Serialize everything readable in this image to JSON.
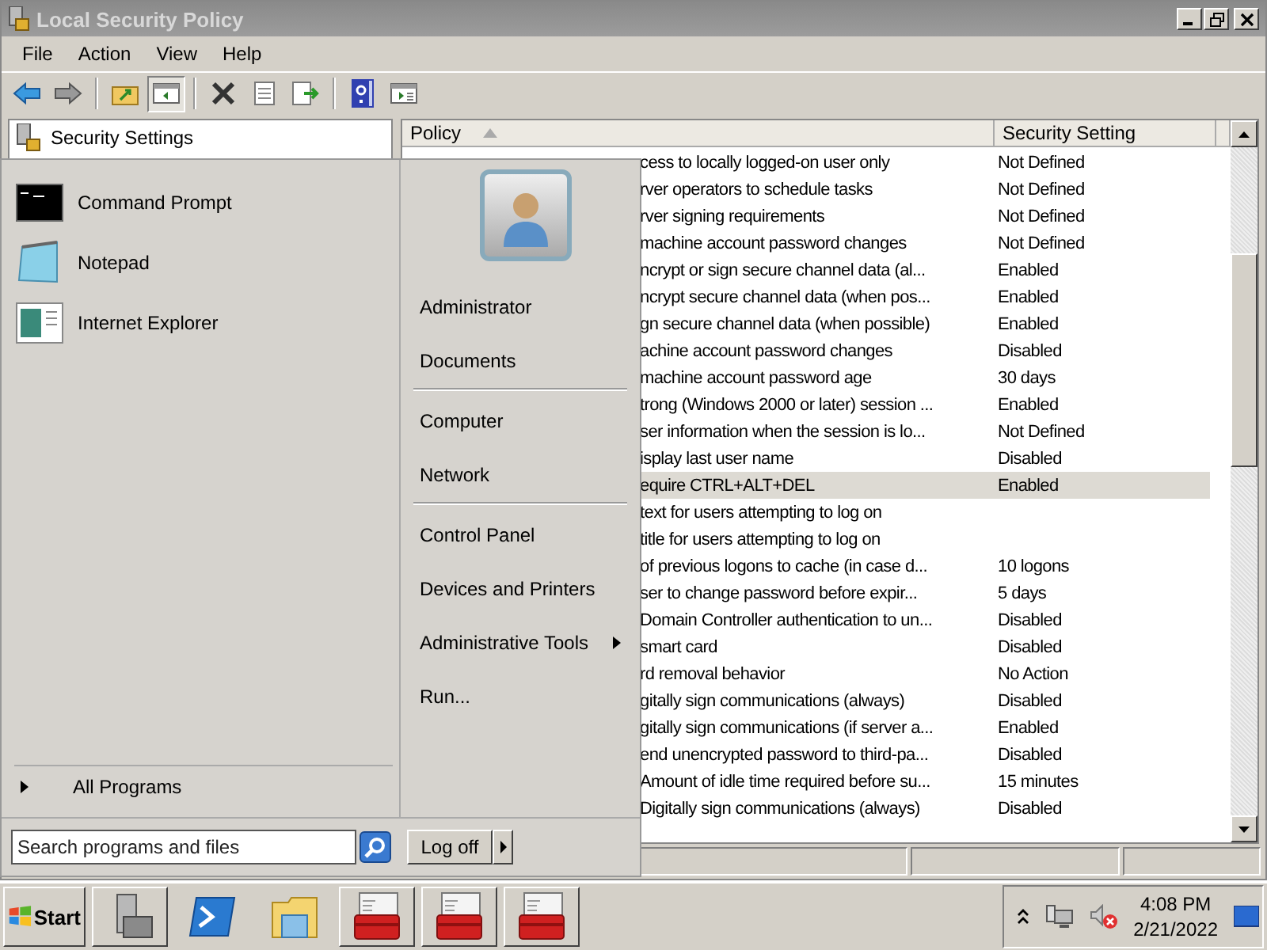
{
  "window": {
    "title": "Local Security Policy"
  },
  "menu": [
    "File",
    "Action",
    "View",
    "Help"
  ],
  "tree": {
    "items": [
      {
        "label": "Security Settings"
      }
    ]
  },
  "table": {
    "columns": [
      {
        "label": "Policy",
        "sorted": true
      },
      {
        "label": "Security Setting",
        "sorted": false
      }
    ],
    "rows": [
      {
        "policy": "cess to locally logged-on user only",
        "setting": "Not Defined",
        "selected": false
      },
      {
        "policy": "rver operators to schedule tasks",
        "setting": "Not Defined",
        "selected": false
      },
      {
        "policy": "rver signing requirements",
        "setting": "Not Defined",
        "selected": false
      },
      {
        "policy": "machine account password changes",
        "setting": "Not Defined",
        "selected": false
      },
      {
        "policy": "ncrypt or sign secure channel data (al...",
        "setting": "Enabled",
        "selected": false
      },
      {
        "policy": "ncrypt secure channel data (when pos...",
        "setting": "Enabled",
        "selected": false
      },
      {
        "policy": "gn secure channel data (when possible)",
        "setting": "Enabled",
        "selected": false
      },
      {
        "policy": "achine account password changes",
        "setting": "Disabled",
        "selected": false
      },
      {
        "policy": "machine account password age",
        "setting": "30 days",
        "selected": false
      },
      {
        "policy": "trong (Windows 2000 or later) session ...",
        "setting": "Enabled",
        "selected": false
      },
      {
        "policy": "ser information when the session is lo...",
        "setting": "Not Defined",
        "selected": false
      },
      {
        "policy": "isplay last user name",
        "setting": "Disabled",
        "selected": false
      },
      {
        "policy": "equire CTRL+ALT+DEL",
        "setting": "Enabled",
        "selected": true
      },
      {
        "policy": "text for users attempting to log on",
        "selected": false
      },
      {
        "policy": "title for users attempting to log on",
        "selected": false
      },
      {
        "policy": "of previous logons to cache (in case d...",
        "setting": "10 logons",
        "selected": false
      },
      {
        "policy": "ser to change password before expir...",
        "setting": "5 days",
        "selected": false
      },
      {
        "policy": "Domain Controller authentication to un...",
        "setting": "Disabled",
        "selected": false
      },
      {
        "policy": "smart card",
        "setting": "Disabled",
        "selected": false
      },
      {
        "policy": "rd removal behavior",
        "setting": "No Action",
        "selected": false
      },
      {
        "policy": "gitally sign communications (always)",
        "setting": "Disabled",
        "selected": false
      },
      {
        "policy": "gitally sign communications (if server a...",
        "setting": "Enabled",
        "selected": false
      },
      {
        "policy": "end unencrypted password to third-pa...",
        "setting": "Disabled",
        "selected": false
      },
      {
        "policy": "Amount of idle time required before su...",
        "setting": "15 minutes",
        "selected": false
      },
      {
        "policy": "Digitally sign communications (always)",
        "setting": "Disabled",
        "selected": false
      }
    ]
  },
  "start_menu": {
    "pinned": [
      {
        "label": "Command Prompt",
        "kind": "cmd"
      },
      {
        "label": "Notepad",
        "kind": "notepad"
      },
      {
        "label": "Internet Explorer",
        "kind": "browser"
      }
    ],
    "link_groups": [
      [
        {
          "label": "Administrator",
          "submenu": false
        },
        {
          "label": "Documents",
          "submenu": false
        }
      ],
      [
        {
          "label": "Computer",
          "submenu": false
        },
        {
          "label": "Network",
          "submenu": false
        }
      ],
      [
        {
          "label": "Control Panel",
          "submenu": false
        },
        {
          "label": "Devices and Printers",
          "submenu": false
        },
        {
          "label": "Administrative Tools",
          "submenu": true
        },
        {
          "label": "Run...",
          "submenu": false
        }
      ]
    ],
    "all_programs": "All Programs",
    "search": {
      "placeholder": "Search programs and files"
    },
    "log_off": "Log off"
  },
  "taskbar": {
    "start": "Start",
    "apps": [
      {
        "kind": "server",
        "open": true
      },
      {
        "kind": "shell",
        "open": false
      },
      {
        "kind": "folder",
        "open": false
      },
      {
        "kind": "toolbox",
        "open": true
      },
      {
        "kind": "toolbox",
        "open": true
      },
      {
        "kind": "toolbox",
        "open": true
      }
    ],
    "clock": {
      "time": "4:08 PM",
      "date": "2/21/2022"
    }
  }
}
